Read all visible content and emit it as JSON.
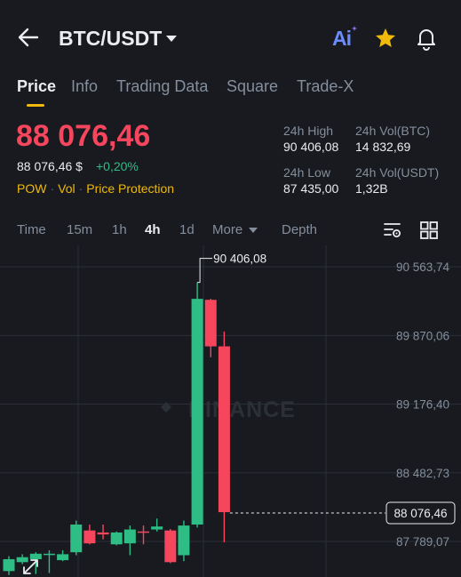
{
  "header": {
    "pair": "BTC/USDT",
    "ai_label": "Ai",
    "icons": [
      "back-arrow-icon",
      "caret-down-icon",
      "star-icon",
      "bell-icon"
    ]
  },
  "tabs": [
    {
      "label": "Price",
      "active": true
    },
    {
      "label": "Info",
      "active": false
    },
    {
      "label": "Trading Data",
      "active": false
    },
    {
      "label": "Square",
      "active": false
    },
    {
      "label": "Trade-X",
      "active": false
    }
  ],
  "ticker": {
    "last_price": "88 076,46",
    "usd_price": "88 076,46 $",
    "change": "+0,20%",
    "tags": [
      "POW",
      "Vol",
      "Price Protection"
    ]
  },
  "stats": {
    "high_label": "24h High",
    "high_value": "90 406,08",
    "low_label": "24h Low",
    "low_value": "87 435,00",
    "vol_btc_label": "24h Vol(BTC)",
    "vol_btc_value": "14 832,69",
    "vol_usdt_label": "24h Vol(USDT)",
    "vol_usdt_value": "1,32B"
  },
  "intervals": [
    {
      "label": "Time",
      "active": false
    },
    {
      "label": "15m",
      "active": false
    },
    {
      "label": "1h",
      "active": false
    },
    {
      "label": "4h",
      "active": true
    },
    {
      "label": "1d",
      "active": false
    },
    {
      "label": "More",
      "active": false
    },
    {
      "label": "Depth",
      "active": false
    }
  ],
  "colors": {
    "background": "#181a20",
    "up": "#2ebd85",
    "down": "#f6465d",
    "accent": "#f0b90b",
    "muted": "#848e9c"
  },
  "chart_data": {
    "type": "candlestick",
    "watermark": "BINANCE",
    "y_ticks": [
      90563.74,
      89870.06,
      89176.4,
      88482.73,
      87789.07
    ],
    "y_tick_labels": [
      "90 563,74",
      "89 870,06",
      "89 176,40",
      "88 482,73",
      "87 789,07"
    ],
    "ylim": [
      87430,
      90780
    ],
    "high_marker": {
      "value": 90406.08,
      "label": "90 406,08"
    },
    "current_price": {
      "value": 88076.46,
      "label": "88 076,46"
    },
    "candles": [
      {
        "open": 87490,
        "close": 87610,
        "high": 87640,
        "low": 87450
      },
      {
        "open": 87580,
        "close": 87630,
        "high": 87660,
        "low": 87560
      },
      {
        "open": 87610,
        "close": 87665,
        "high": 87680,
        "low": 87460
      },
      {
        "open": 87660,
        "close": 87665,
        "high": 87700,
        "low": 87470
      },
      {
        "open": 87600,
        "close": 87660,
        "high": 87700,
        "low": 87590
      },
      {
        "open": 87680,
        "close": 87960,
        "high": 88000,
        "low": 87650
      },
      {
        "open": 87900,
        "close": 87770,
        "high": 87960,
        "low": 87760
      },
      {
        "open": 87880,
        "close": 87860,
        "high": 87960,
        "low": 87810
      },
      {
        "open": 87760,
        "close": 87880,
        "high": 87890,
        "low": 87750
      },
      {
        "open": 87770,
        "close": 87910,
        "high": 87950,
        "low": 87650
      },
      {
        "open": 87890,
        "close": 87880,
        "high": 87950,
        "low": 87760
      },
      {
        "open": 87910,
        "close": 87940,
        "high": 88020,
        "low": 87890
      },
      {
        "open": 87900,
        "close": 87580,
        "high": 87915,
        "low": 87570
      },
      {
        "open": 87650,
        "close": 87950,
        "high": 88000,
        "low": 87590
      },
      {
        "open": 87960,
        "close": 90240,
        "high": 90406.08,
        "low": 87930
      },
      {
        "open": 90230,
        "close": 89760,
        "high": 90240,
        "low": 89650
      },
      {
        "open": 89760,
        "close": 88085,
        "high": 89910,
        "low": 87780
      }
    ]
  }
}
